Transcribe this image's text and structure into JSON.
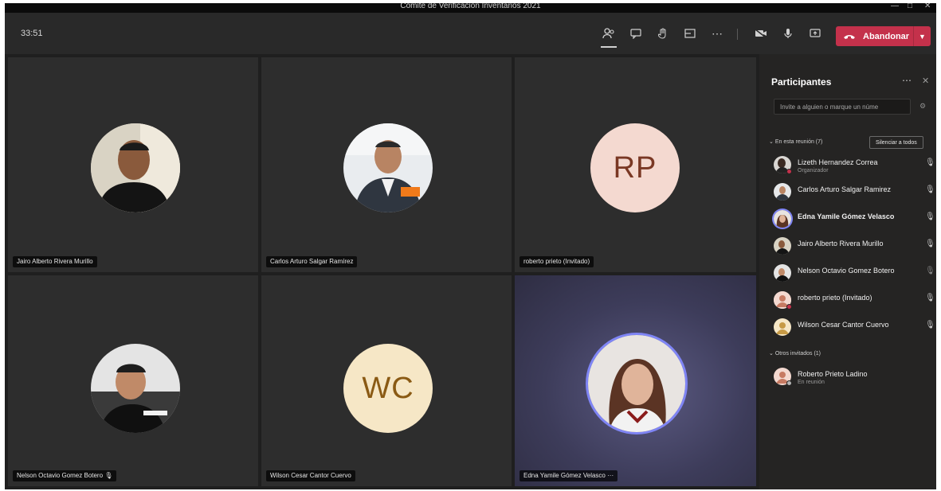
{
  "app": {
    "window_title": "Comité de Verificación Inventarios 2021",
    "timer": "33:51",
    "leave_label": "Abandonar"
  },
  "toolbar": {
    "icons": [
      "participants-icon",
      "chat-icon",
      "raise-hand-icon",
      "breakout-rooms-icon",
      "more-options-icon",
      "camera-icon",
      "microphone-icon",
      "share-screen-icon"
    ]
  },
  "tiles": [
    {
      "name": "Jairo Alberto Rivera Murillo",
      "type": "photo",
      "photo": "man-dark-shirt"
    },
    {
      "name": "Carlos Arturo Salgar Ramírez",
      "type": "photo",
      "photo": "man-suit"
    },
    {
      "name": "roberto prieto (Invitado)",
      "type": "initials",
      "initials": "RP",
      "bg": "#f4d9d0",
      "fg": "#7a3824"
    },
    {
      "name": "Nelson Octavio Gomez Botero",
      "type": "photo",
      "photo": "man-smiling",
      "muted": true
    },
    {
      "name": "Wilson Cesar Cantor Cuervo",
      "type": "initials",
      "initials": "WC",
      "bg": "#f6e7c6",
      "fg": "#8a5a14"
    },
    {
      "name": "Edna Yamile Gómez Velasco",
      "type": "photo",
      "photo": "woman",
      "speaking": true,
      "more": "···"
    }
  ],
  "panel": {
    "title": "Participantes",
    "invite_placeholder": "Invite a alguien o marque un núme",
    "in_meeting_label": "En esta reunión (7)",
    "mute_all_label": "Silenciar a todos",
    "others_label": "Otros invitados (1)",
    "participants": [
      {
        "name": "Lizeth Hernandez Correa",
        "role": "Organizador",
        "mic": "on"
      },
      {
        "name": "Carlos Arturo Salgar Ramirez",
        "role": "",
        "mic": "on"
      },
      {
        "name": "Edna Yamile Gómez Velasco",
        "role": "",
        "mic": "on",
        "bold": true
      },
      {
        "name": "Jairo Alberto Rivera Murillo",
        "role": "",
        "mic": "on"
      },
      {
        "name": "Nelson Octavio Gomez Botero",
        "role": "",
        "mic": "muted"
      },
      {
        "name": "roberto prieto (Invitado)",
        "role": "",
        "mic": "on"
      },
      {
        "name": "Wilson Cesar Cantor Cuervo",
        "role": "",
        "mic": "on"
      }
    ],
    "others": [
      {
        "name": "Roberto Prieto Ladino",
        "role": "En reunión"
      }
    ]
  },
  "colors": {
    "leave": "#c4314b",
    "speaking_ring": "#7f85f5",
    "background": "#1f1f1f"
  }
}
